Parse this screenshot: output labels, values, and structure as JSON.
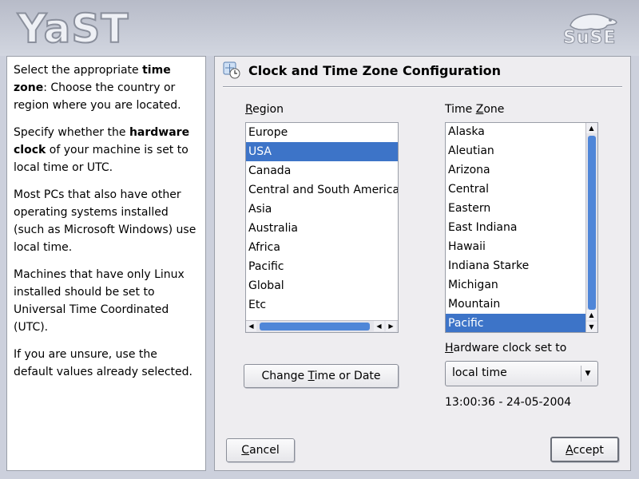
{
  "header": {
    "logo_text": "YaST",
    "brand_text": "SuSE"
  },
  "help": {
    "paragraphs": [
      {
        "pre": "Select the appropriate ",
        "bold": "time zone",
        "post": ": Choose the country or region where you are located."
      },
      {
        "pre": "Specify whether the ",
        "bold": "hardware clock",
        "post": " of your machine is set to local time or UTC."
      },
      {
        "pre": "Most PCs that also have other operating systems installed (such as Microsoft Windows) use local time.",
        "bold": "",
        "post": ""
      },
      {
        "pre": "Machines that have only Linux installed should be set to Universal Time Coordinated (UTC).",
        "bold": "",
        "post": ""
      },
      {
        "pre": "If you are unsure, use the default values already selected.",
        "bold": "",
        "post": ""
      }
    ]
  },
  "dialog": {
    "title": "Clock and Time Zone Configuration",
    "region_label_u": "R",
    "region_label_rest": "egion",
    "region_items": [
      "Europe",
      "USA",
      "Canada",
      "Central and South America",
      "Asia",
      "Australia",
      "Africa",
      "Pacific",
      "Global",
      "Etc"
    ],
    "region_selected": "USA",
    "tz_label_pre": "Time ",
    "tz_label_u": "Z",
    "tz_label_rest": "one",
    "tz_items": [
      "Alaska",
      "Aleutian",
      "Arizona",
      "Central",
      "Eastern",
      "East Indiana",
      "Hawaii",
      "Indiana Starke",
      "Michigan",
      "Mountain",
      "Pacific"
    ],
    "tz_selected": "Pacific",
    "change_btn_pre": "Change ",
    "change_btn_u": "T",
    "change_btn_rest": "ime or Date",
    "hwclock_label_u": "H",
    "hwclock_label_rest": "ardware clock set to",
    "hwclock_value": "local time",
    "datetime": "13:00:36 - 24-05-2004",
    "cancel_u": "C",
    "cancel_rest": "ancel",
    "accept_u": "A",
    "accept_rest": "ccept"
  },
  "colors": {
    "selection": "#3d74c8",
    "scroll_thumb": "#4f86d8"
  }
}
